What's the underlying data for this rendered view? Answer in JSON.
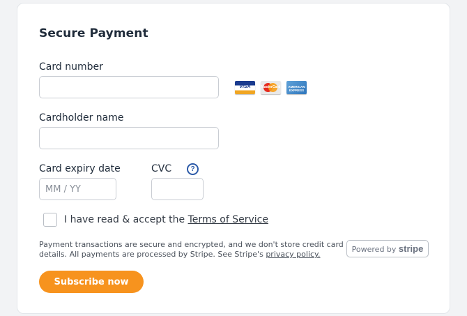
{
  "form": {
    "title": "Secure Payment",
    "card_number": {
      "label": "Card number",
      "value": "",
      "placeholder": ""
    },
    "cardholder": {
      "label": "Cardholder name",
      "value": "",
      "placeholder": ""
    },
    "expiry": {
      "label": "Card expiry date",
      "value": "",
      "placeholder": "MM / YY"
    },
    "cvc": {
      "label": "CVC",
      "value": "",
      "placeholder": "",
      "help_icon": "question-circle-icon",
      "help_glyph": "?"
    },
    "card_brands": [
      {
        "name": "visa-icon",
        "text": "VISA"
      },
      {
        "name": "mastercard-icon",
        "text": "MasterCard"
      },
      {
        "name": "amex-icon",
        "text": "AMERICAN EXPRESS"
      }
    ],
    "terms": {
      "prefix": "I have read & accept the ",
      "link": "Terms of Service",
      "checked": false
    },
    "disclaimer": {
      "text": "Payment transactions are secure and encrypted, and we don't store credit card details. All payments are processed by Stripe. See Stripe's ",
      "link": "privacy policy."
    },
    "stripe_badge": {
      "prefix": "Powered by ",
      "brand": "stripe"
    },
    "submit_label": "Subscribe now"
  },
  "colors": {
    "accent": "#f7931e",
    "help_icon": "#2c5aa8",
    "background": "#f2f3f5",
    "card": "#ffffff"
  }
}
